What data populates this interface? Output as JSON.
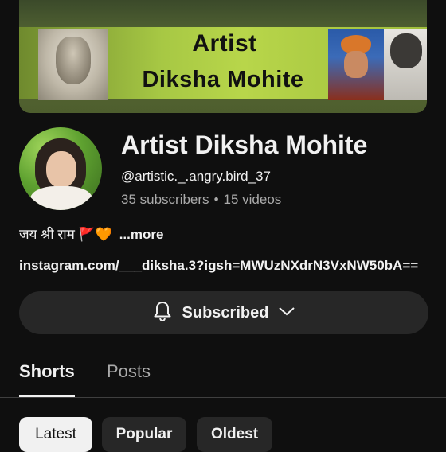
{
  "banner": {
    "line1": "Artist",
    "line2": "Diksha Mohite"
  },
  "channel": {
    "name": "Artist Diksha Mohite",
    "handle": "@artistic._.angry.bird_37",
    "subscribers": "35 subscribers",
    "separator": "•",
    "videos": "15 videos"
  },
  "description": {
    "text": "जय श्री राम 🚩🧡",
    "more": "...more"
  },
  "link": "instagram.com/___diksha.3?igsh=MWUzNXdrN3VxNW50bA==",
  "subscribe": {
    "label": "Subscribed",
    "icon": "bell-icon"
  },
  "tabs": [
    {
      "label": "Shorts",
      "selected": true
    },
    {
      "label": "Posts",
      "selected": false
    }
  ],
  "filters": [
    {
      "label": "Latest",
      "selected": true
    },
    {
      "label": "Popular",
      "selected": false
    },
    {
      "label": "Oldest",
      "selected": false
    }
  ],
  "colors": {
    "background": "#0f0f0f",
    "surface": "#272727",
    "text": "#f1f1f1",
    "secondary_text": "#aaaaaa"
  }
}
